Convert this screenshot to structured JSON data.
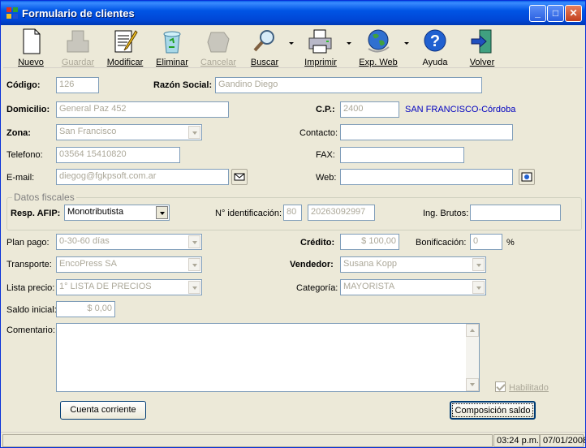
{
  "window": {
    "title": "Formulario de clientes"
  },
  "toolbar": {
    "nuevo": "Nuevo",
    "guardar": "Guardar",
    "modificar": "Modificar",
    "eliminar": "Eliminar",
    "cancelar": "Cancelar",
    "buscar": "Buscar",
    "imprimir": "Imprimir",
    "exp_web": "Exp. Web",
    "ayuda": "Ayuda",
    "volver": "Volver"
  },
  "form": {
    "codigo_label": "Código:",
    "codigo": "126",
    "razon_label": "Razón Social:",
    "razon": "Gandino Diego",
    "domicilio_label": "Domicilio:",
    "domicilio": "General Paz 452",
    "cp_label": "C.P.:",
    "cp": "2400",
    "localidad": "SAN FRANCISCO-Córdoba",
    "zona_label": "Zona:",
    "zona": "San Francisco",
    "contacto_label": "Contacto:",
    "contacto": "",
    "telefono_label": "Telefono:",
    "telefono": "03564 15410820",
    "fax_label": "FAX:",
    "fax": "",
    "email_label": "E-mail:",
    "email": "diegog@fgkpsoft.com.ar",
    "web_label": "Web:",
    "web": ""
  },
  "fiscal": {
    "group_title": "Datos fiscales",
    "resp_label": "Resp. AFIP:",
    "resp": "Monotributista",
    "nro_label": "N° identificación:",
    "nro_tipo": "80",
    "nro": "20263092997",
    "ingb_label": "Ing. Brutos:",
    "ingb": ""
  },
  "comercial": {
    "plan_label": "Plan pago:",
    "plan": "0-30-60 días",
    "credito_label": "Crédito:",
    "credito": "$ 100,00",
    "bonif_label": "Bonificación:",
    "bonif": "0",
    "pct": "%",
    "transp_label": "Transporte:",
    "transp": "EncoPress SA",
    "vendedor_label": "Vendedor:",
    "vendedor": "Susana Kopp",
    "lista_label": "Lista precio:",
    "lista": "1° LISTA DE PRECIOS",
    "categoria_label": "Categoría:",
    "categoria": "MAYORISTA",
    "saldo_label": "Saldo inicial:",
    "saldo": "$ 0,00",
    "comentario_label": "Comentario:",
    "comentario": "",
    "habilitado": "Habilitado"
  },
  "buttons": {
    "cuenta": "Cuenta corriente",
    "composicion": "Composición saldo"
  },
  "status": {
    "time": "03:24 p.m.",
    "date": "07/01/2008"
  }
}
